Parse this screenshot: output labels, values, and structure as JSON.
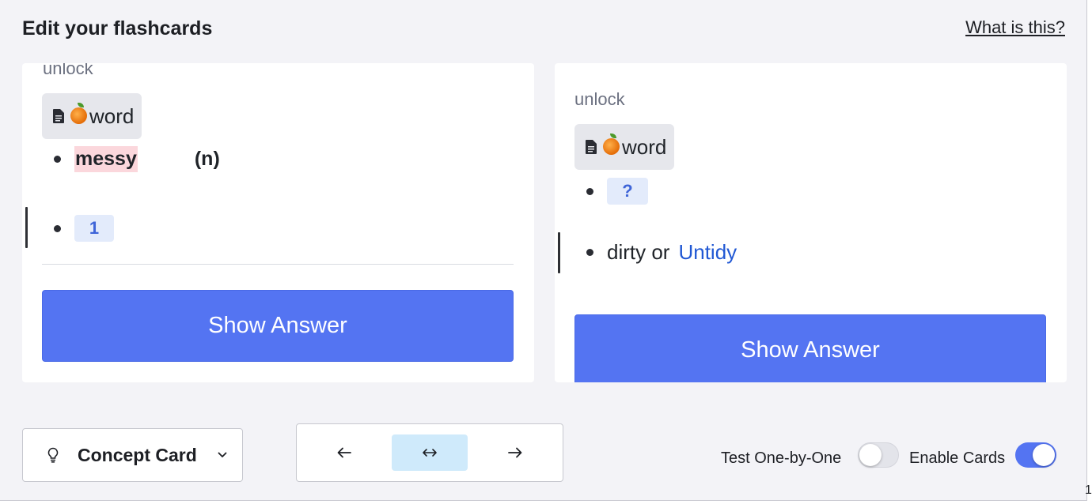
{
  "header": {
    "title": "Edit your flashcards",
    "help_link": "What is this?"
  },
  "cards": {
    "left": {
      "deck": "unlock",
      "tag_label": "word",
      "term": "messy",
      "part_of_speech": "(n)",
      "chip": "1",
      "button": "Show Answer"
    },
    "right": {
      "deck": "unlock",
      "tag_label": "word",
      "chip": "?",
      "answer_text": "dirty or",
      "answer_link": "Untidy",
      "button": "Show Answer"
    }
  },
  "footer": {
    "card_type": "Concept Card",
    "nav": {
      "prev": "←",
      "flip": "↔",
      "next": "→"
    },
    "toggles": {
      "test_one_by_one": {
        "label": "Test One-by-One",
        "on": false
      },
      "enable_cards": {
        "label": "Enable Cards",
        "on": true
      }
    },
    "edge_glyph": "1"
  },
  "colors": {
    "accent": "#5474f2",
    "link": "#2158d4",
    "highlight": "#fbd7dc",
    "chip_bg": "#e3ebfb",
    "active_nav": "#cfeafb"
  },
  "icons": [
    "document-icon",
    "orange-icon",
    "lightbulb-icon",
    "chevron-down-icon",
    "arrow-left-icon",
    "arrow-left-right-icon",
    "arrow-right-icon"
  ]
}
